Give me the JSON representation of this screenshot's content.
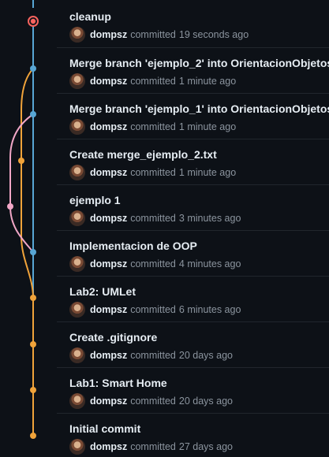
{
  "colors": {
    "background": "#0d1117",
    "divider": "#21262d",
    "branch_main": "#58a6d4",
    "branch_lab": "#f0a33a",
    "branch_pink": "#f1a7c7",
    "head_marker": "#f8635e"
  },
  "commits": [
    {
      "title": "cleanup",
      "author": "dompsz",
      "action": "committed",
      "time": "19 seconds ago",
      "avatar": "avatar-icon"
    },
    {
      "title": "Merge branch 'ejemplo_2' into OrientacionObjetos",
      "author": "dompsz",
      "action": "committed",
      "time": "1 minute ago",
      "avatar": "avatar-icon"
    },
    {
      "title": "Merge branch 'ejemplo_1' into OrientacionObjetos",
      "author": "dompsz",
      "action": "committed",
      "time": "1 minute ago",
      "avatar": "avatar-icon"
    },
    {
      "title": "Create merge_ejemplo_2.txt",
      "author": "dompsz",
      "action": "committed",
      "time": "1 minute ago",
      "avatar": "avatar-icon"
    },
    {
      "title": "ejemplo 1",
      "author": "dompsz",
      "action": "committed",
      "time": "3 minutes ago",
      "avatar": "avatar-icon"
    },
    {
      "title": "Implementacion de OOP",
      "author": "dompsz",
      "action": "committed",
      "time": "4 minutes ago",
      "avatar": "avatar-icon"
    },
    {
      "title": "Lab2: UMLet",
      "author": "dompsz",
      "action": "committed",
      "time": "6 minutes ago",
      "avatar": "avatar-icon"
    },
    {
      "title": "Create .gitignore",
      "author": "dompsz",
      "action": "committed",
      "time": "20 days ago",
      "avatar": "avatar-icon"
    },
    {
      "title": "Lab1: Smart Home",
      "author": "dompsz",
      "action": "committed",
      "time": "20 days ago",
      "avatar": "avatar-icon"
    },
    {
      "title": "Initial commit",
      "author": "dompsz",
      "action": "committed",
      "time": "27 days ago",
      "avatar": "avatar-icon"
    }
  ]
}
